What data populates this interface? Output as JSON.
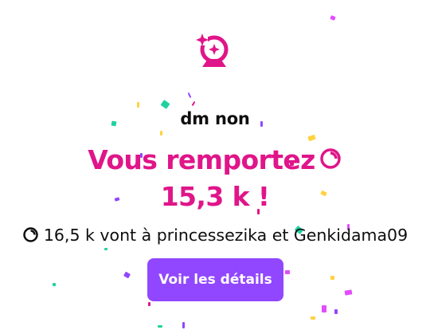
{
  "prediction": {
    "logo_icon": "crystal-ball-sparkle-icon",
    "question": "dm non",
    "win_line1": "Vous remportez",
    "win_amount": "15,3 k !",
    "points_icon": "channel-points-icon",
    "summary": "16,5 k vont à princessezika et Genkidama09",
    "details_button": "Voir les détails"
  },
  "colors": {
    "accent_pink": "#e01589",
    "button_purple": "#9147ff",
    "text_dark": "#0e0e10",
    "background": "#ffffff"
  }
}
